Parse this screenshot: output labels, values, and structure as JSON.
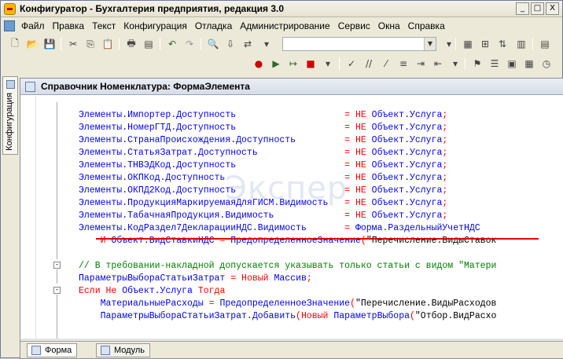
{
  "window": {
    "title": "Конфигуратор - Бухгалтерия предприятия, редакция 3.0",
    "buttons": [
      "_",
      "□",
      "X"
    ]
  },
  "menu": [
    {
      "label": "Файл"
    },
    {
      "label": "Правка"
    },
    {
      "label": "Текст"
    },
    {
      "label": "Конфигурация"
    },
    {
      "label": "Отладка"
    },
    {
      "label": "Администрирование"
    },
    {
      "label": "Сервис"
    },
    {
      "label": "Окна"
    },
    {
      "label": "Справка"
    }
  ],
  "sidebar": {
    "tab_label": "Конфигурация"
  },
  "editor": {
    "title": "Справочник Номенклатура: ФормаЭлемента",
    "watermark": "Экспер"
  },
  "code_lines": [
    "Элементы.Импортер.Доступность                    = НЕ Объект.Услуга;",
    "Элементы.НомерГТД.Доступность                    = НЕ Объект.Услуга;",
    "Элементы.СтранаПроисхождения.Доступность         = НЕ Объект.Услуга;",
    "Элементы.СтатьяЗатрат.Доступность                = НЕ Объект.Услуга;",
    "Элементы.ТНВЭДКод.Доступность                    = НЕ Объект.Услуга;",
    "Элементы.ОКПКод.Доступность                      = НЕ Объект.Услуга;",
    "Элементы.ОКПД2Код.Доступность                    = НЕ Объект.Услуга;",
    "Элементы.ПродукцияМаркируемаяДляГИСМ.Видимость   = НЕ Объект.Услуга;",
    "Элементы.ТабачнаяПродукция.Видимость             = НЕ Объект.Услуга;",
    "Элементы.КодРаздел7ДекларацииНДС.Видимость       = Форма.РаздельныйУчетНДС",
    "    И Объект.ВидСтавкиНДС = ПредопределенноеЗначение(\"Перечисление.ВидыСтавок",
    "",
    "// В требовании-накладной допускается указывать только статьи с видом \"Матери",
    "ПараметрыВыбораСтатьиЗатрат = Новый Массив;",
    "Если Не Объект.Услуга Тогда",
    "    МатериальныеРасходы = ПредопределенноеЗначение(\"Перечисление.ВидыРасходов",
    "    ПараметрыВыбораСтатьиЗатрат.Добавить(Новый ПараметрВыбора(\"Отбор.ВидРасхо"
  ],
  "bottom_tabs": [
    {
      "label": "Форма",
      "active": true
    },
    {
      "label": "Модуль",
      "active": false
    }
  ],
  "colors": {
    "identifier": "#0000ff",
    "keyword": "#ff0000",
    "comment": "#008000",
    "string": "#000000",
    "highlight_underline": "#e60000"
  }
}
